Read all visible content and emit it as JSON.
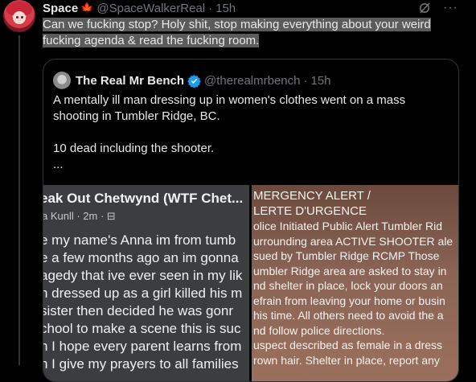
{
  "tweet": {
    "author_name": "Space",
    "flag": "🍁",
    "handle": "@SpaceWalkerReal",
    "separator": "·",
    "time": "15h",
    "text_line1": "Can we fucking stop? Holy shit, stop making everything about your weird",
    "text_line2": "fucking agenda & read the fucking room.",
    "more": "···"
  },
  "quote": {
    "author_name": "The Real Mr Bench",
    "handle": "@therealmrbench",
    "separator": "·",
    "time": "15h",
    "para1": "A mentally ill man dressing up in women's clothes went on a mass shooting in Tumbler Ridge, BC.",
    "para2": "10 dead including the shooter.",
    "para3": "...",
    "verified_color": "#1d9bf0"
  },
  "media_left": {
    "title": "eak Out Chetwynd (WTF Chet...",
    "subtitle": "a Kunll · 2m · ⊟",
    "lines": [
      "e  my name's Anna im from tumb",
      "e a few months ago an im gonna",
      "agedy that ive ever seen in my lik",
      "n dressed up as a girl  killed his m",
      " sister  then decided he was gonr",
      "chool to make a scene   this is suc",
      "n I hope every  parent learns from",
      "n I give my prayers  to all families"
    ]
  },
  "media_right": {
    "lines": [
      "MERGENCY ALERT /",
      "LERTE D'URGENCE",
      "olice Initiated Public Alert Tumbler Rid",
      "urrounding area ACTIVE SHOOTER ale",
      "sued by Tumbler Ridge RCMP Those",
      "umbler Ridge area are asked to stay in",
      "nd shelter in place, lock your doors an",
      "efrain from leaving your home or busin",
      "his time.  All others need to avoid the a",
      "nd follow police directions.",
      "uspect described as female in a dress",
      "rown hair. Shelter in place, report any"
    ]
  }
}
